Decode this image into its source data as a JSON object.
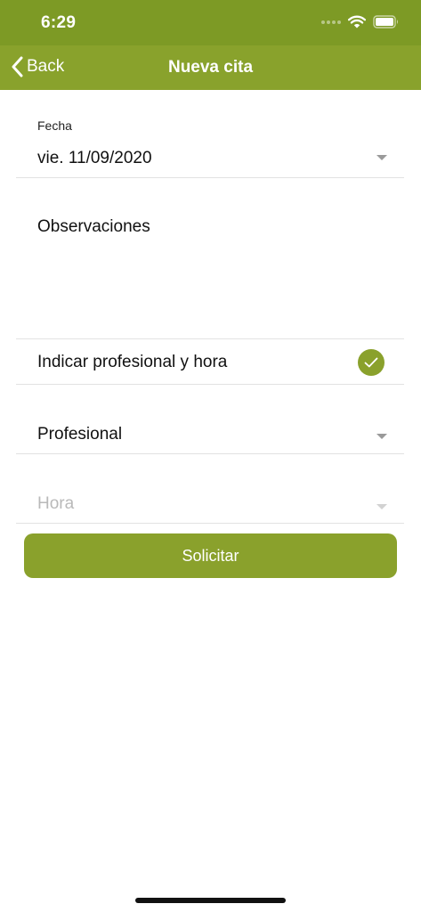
{
  "status_bar": {
    "time": "6:29"
  },
  "nav": {
    "back_label": "Back",
    "title": "Nueva cita"
  },
  "form": {
    "date_label": "Fecha",
    "date_value": "vie. 11/09/2020",
    "observations_label": "Observaciones",
    "toggle_label": "Indicar profesional y hora",
    "toggle_checked": true,
    "professional_label": "Profesional",
    "hour_label": "Hora"
  },
  "submit_label": "Solicitar",
  "colors": {
    "status_bar": "#7d9a25",
    "nav_bar": "#89a22c",
    "accent": "#8aa12c",
    "disabled_text": "#b9b9b9"
  }
}
